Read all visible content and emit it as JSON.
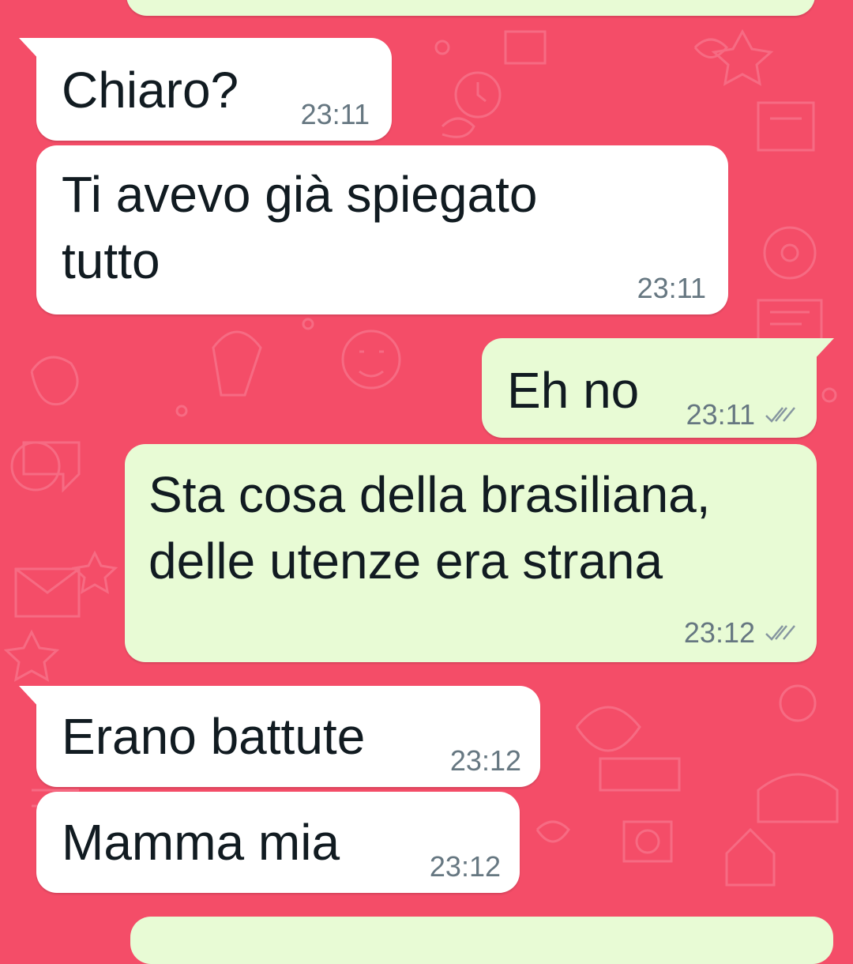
{
  "colors": {
    "wallpaper": "#f44d68",
    "incoming_bubble": "#ffffff",
    "outgoing_bubble": "#e8fbd5",
    "timestamp": "#667781",
    "ticks": "#8696a0"
  },
  "messages": [
    {
      "direction": "incoming",
      "text": "Chiaro?",
      "time": "23:11"
    },
    {
      "direction": "incoming",
      "text": "Ti avevo già spiegato\ntutto",
      "time": "23:11"
    },
    {
      "direction": "outgoing",
      "text": "Eh no",
      "time": "23:11",
      "status_icon": "double-check-icon"
    },
    {
      "direction": "outgoing",
      "text": "Sta cosa della brasiliana,\ndelle utenze era strana",
      "time": "23:12",
      "status_icon": "double-check-icon"
    },
    {
      "direction": "incoming",
      "text": "Erano battute",
      "time": "23:12"
    },
    {
      "direction": "incoming",
      "text": "Mamma mia",
      "time": "23:12"
    }
  ]
}
